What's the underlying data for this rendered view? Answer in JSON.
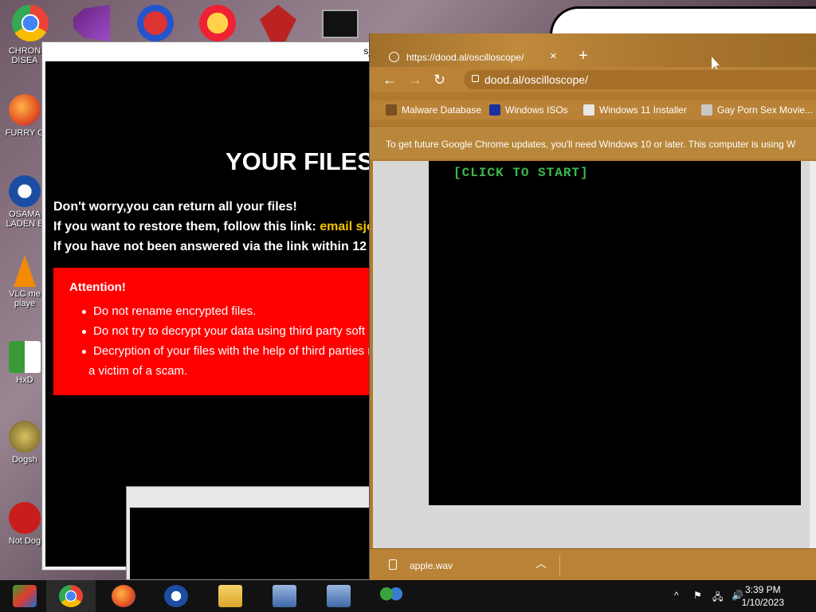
{
  "desktop": {
    "icons": [
      {
        "label": "CHRON DISEA",
        "icon": "chrome-icon"
      },
      {
        "label": "FURRY C",
        "icon": "firefox-icon"
      },
      {
        "label": "OSAMA LADEN E",
        "icon": "obama-logo-icon"
      },
      {
        "label": "VLC me playe",
        "icon": "vlc-cone-icon"
      },
      {
        "label": "HxD",
        "icon": "hxd-icon"
      },
      {
        "label": "Dogsh",
        "icon": "dog-icon"
      },
      {
        "label": "Not Dog",
        "icon": "devcpp-icon"
      }
    ],
    "top_icons": [
      "chrome-icon",
      "visual-studio-icon",
      "2-icon",
      "p-icon",
      "red-tool-icon",
      "cmd-icon"
    ]
  },
  "ransom": {
    "title_fragment": "sj",
    "heading": "YOUR FILES",
    "line1": "Don't worry,you can return all your files!",
    "line2_prefix": "If you want to restore them, follow this link: ",
    "line2_link": "email sje",
    "line3": "If you have not been answered via the link within 12",
    "attention": "Attention!",
    "bullets": [
      "Do not rename encrypted files.",
      "Do not try to decrypt your data using third party soft",
      "Decryption of your files with the help of third parties r",
      "a victim of a scam."
    ]
  },
  "chrome": {
    "tab_title": "https://dood.al/oscilloscope/",
    "tab_close": "×",
    "new_tab": "+",
    "url": "dood.al/oscilloscope/",
    "bookmarks": [
      {
        "label": "Malware Database",
        "color": "#7a5020"
      },
      {
        "label": "Windows ISOs",
        "color": "#1c2fa0"
      },
      {
        "label": "Windows 11 Installer",
        "color": "#e8e8e8"
      },
      {
        "label": "Gay Porn Sex Movie...",
        "color": "#c8c8c8"
      }
    ],
    "infobar": "To get future Google Chrome updates, you'll need Windows 10 or later. This computer is using W",
    "scope_text": "[CLICK TO START]",
    "download_name": "apple.wav",
    "theme_color": "#b98236"
  },
  "taskbar": {
    "buttons": [
      "start-icon",
      "chrome-icon",
      "firefox-icon",
      "obama-logo-icon",
      "file-explorer-icon",
      "setup-icon",
      "setup-icon-2",
      "network-people-icon"
    ],
    "time": "3:39 PM",
    "date": "1/10/2023"
  }
}
